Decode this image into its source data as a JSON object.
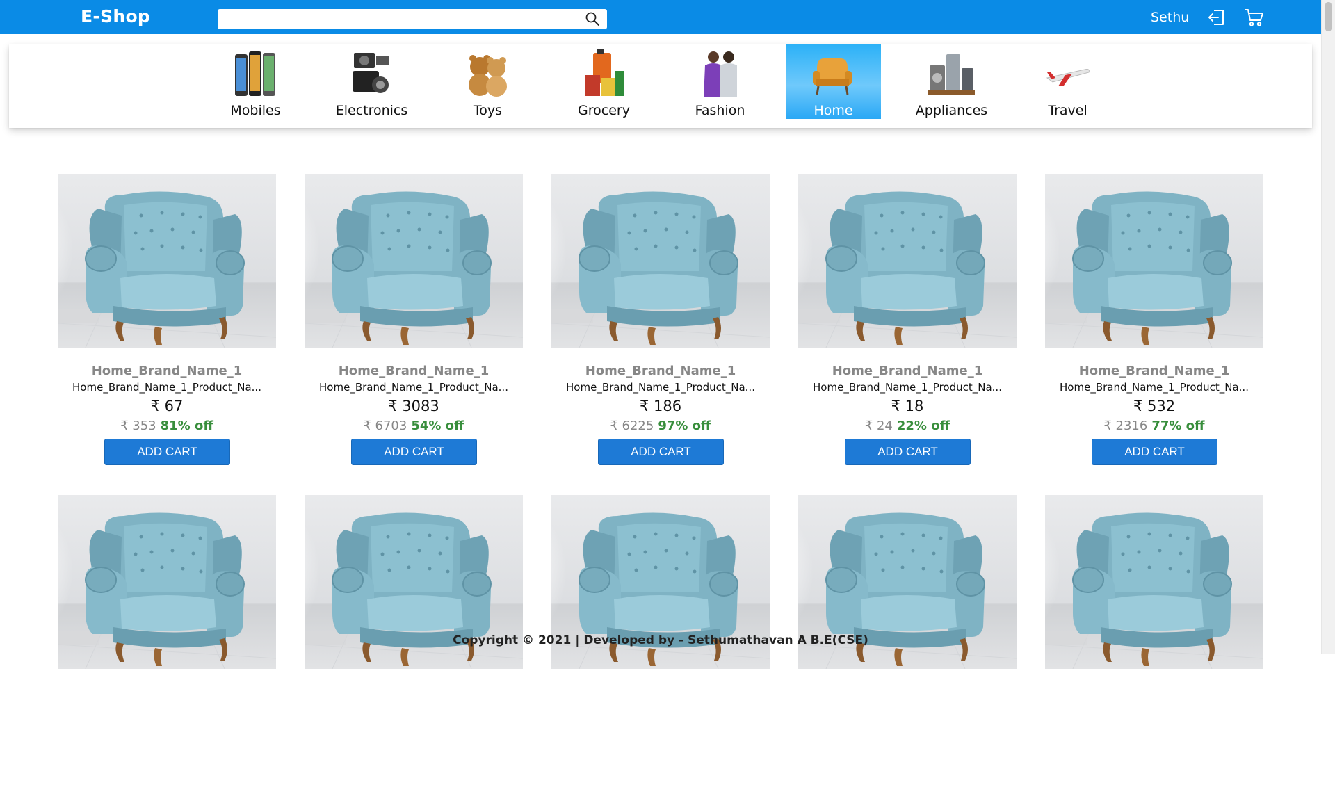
{
  "header": {
    "logo": "E-Shop",
    "search": {
      "value": "",
      "placeholder": ""
    },
    "user_name": "Sethu",
    "icons": {
      "search": "search-icon",
      "logout": "logout-icon",
      "cart": "cart-icon"
    }
  },
  "categories": [
    {
      "label": "Mobiles",
      "active": false,
      "icon": "mobiles-icon"
    },
    {
      "label": "Electronics",
      "active": false,
      "icon": "electronics-icon"
    },
    {
      "label": "Toys",
      "active": false,
      "icon": "toys-icon"
    },
    {
      "label": "Grocery",
      "active": false,
      "icon": "grocery-icon"
    },
    {
      "label": "Fashion",
      "active": false,
      "icon": "fashion-icon"
    },
    {
      "label": "Home",
      "active": true,
      "icon": "home-icon"
    },
    {
      "label": "Appliances",
      "active": false,
      "icon": "appliances-icon"
    },
    {
      "label": "Travel",
      "active": false,
      "icon": "travel-icon"
    }
  ],
  "products": [
    {
      "brand": "Home_Brand_Name_1",
      "name": "Home_Brand_Name_1_Product_Na...",
      "price": "₹ 67",
      "mrp": "₹ 353",
      "off": "81% off",
      "button": "ADD CART"
    },
    {
      "brand": "Home_Brand_Name_1",
      "name": "Home_Brand_Name_1_Product_Na...",
      "price": "₹ 3083",
      "mrp": "₹ 6703",
      "off": "54% off",
      "button": "ADD CART"
    },
    {
      "brand": "Home_Brand_Name_1",
      "name": "Home_Brand_Name_1_Product_Na...",
      "price": "₹ 186",
      "mrp": "₹ 6225",
      "off": "97% off",
      "button": "ADD CART"
    },
    {
      "brand": "Home_Brand_Name_1",
      "name": "Home_Brand_Name_1_Product_Na...",
      "price": "₹ 18",
      "mrp": "₹ 24",
      "off": "22% off",
      "button": "ADD CART"
    },
    {
      "brand": "Home_Brand_Name_1",
      "name": "Home_Brand_Name_1_Product_Na...",
      "price": "₹ 532",
      "mrp": "₹ 2316",
      "off": "77% off",
      "button": "ADD CART"
    },
    {
      "image_only": true
    },
    {
      "image_only": true
    },
    {
      "image_only": true
    },
    {
      "image_only": true
    },
    {
      "image_only": true
    }
  ],
  "footer": {
    "text": "Copyright © 2021 | Developed by - Sethumathavan A B.E(CSE)"
  },
  "colors": {
    "header": "#0a8be6",
    "button": "#1e7ad6",
    "discount": "#388e3c",
    "active_tab": "#2cb1f7"
  }
}
